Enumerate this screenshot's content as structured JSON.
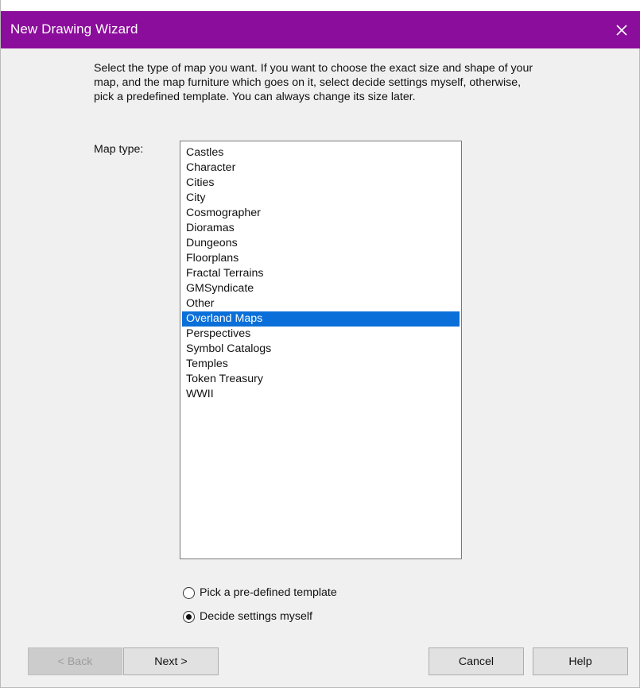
{
  "window": {
    "title": "New Drawing Wizard",
    "title_bar_color": "#8b0d9b"
  },
  "description": "Select the type of map you want. If you want to choose the exact size and shape of your map, and the map furniture which goes on it, select decide settings myself, otherwise, pick a predefined template. You can always change its size later.",
  "map_type": {
    "label": "Map type:",
    "items": [
      {
        "label": "Castles",
        "selected": false
      },
      {
        "label": "Character",
        "selected": false
      },
      {
        "label": "Cities",
        "selected": false
      },
      {
        "label": "City",
        "selected": false
      },
      {
        "label": "Cosmographer",
        "selected": false
      },
      {
        "label": "Dioramas",
        "selected": false
      },
      {
        "label": "Dungeons",
        "selected": false
      },
      {
        "label": "Floorplans",
        "selected": false
      },
      {
        "label": "Fractal Terrains",
        "selected": false
      },
      {
        "label": "GMSyndicate",
        "selected": false
      },
      {
        "label": "Other",
        "selected": false
      },
      {
        "label": "Overland Maps",
        "selected": true
      },
      {
        "label": "Perspectives",
        "selected": false
      },
      {
        "label": "Symbol Catalogs",
        "selected": false
      },
      {
        "label": "Temples",
        "selected": false
      },
      {
        "label": "Token Treasury",
        "selected": false
      },
      {
        "label": "WWII",
        "selected": false
      }
    ],
    "selection_color": "#0a6fd8"
  },
  "options": {
    "template_label": "Pick a pre-defined template",
    "template_checked": false,
    "custom_label": "Decide settings myself",
    "custom_checked": true
  },
  "buttons": {
    "back": "< Back",
    "back_enabled": false,
    "next": "Next >",
    "cancel": "Cancel",
    "help": "Help"
  },
  "icons": {
    "close": "close-icon"
  }
}
